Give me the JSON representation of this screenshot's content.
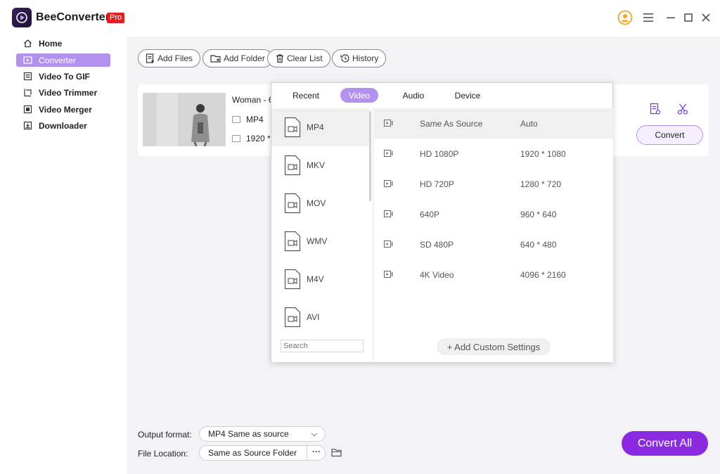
{
  "app": {
    "title": "BeeConverter",
    "badge": "Pro"
  },
  "sidebar": {
    "items": [
      {
        "label": "Home",
        "icon": "home-icon"
      },
      {
        "label": "Converter",
        "icon": "converter-icon",
        "active": true
      },
      {
        "label": "Video To GIF",
        "icon": "gif-icon"
      },
      {
        "label": "Video Trimmer",
        "icon": "trim-icon"
      },
      {
        "label": "Video Merger",
        "icon": "merge-icon"
      },
      {
        "label": "Downloader",
        "icon": "download-icon"
      }
    ]
  },
  "toolbar": {
    "add_files": "Add Files",
    "add_folder": "Add Folder",
    "clear_list": "Clear List",
    "history": "History"
  },
  "file": {
    "name": "Woman - 6",
    "format": "MP4",
    "resolution": "1920 *",
    "convert_label": "Convert"
  },
  "popup": {
    "tabs": [
      "Recent",
      "Video",
      "Audio",
      "Device"
    ],
    "active_tab": "Video",
    "formats": [
      "MP4",
      "MKV",
      "MOV",
      "WMV",
      "M4V",
      "AVI"
    ],
    "active_format": "MP4",
    "search_placeholder": "Search",
    "presets": [
      {
        "name": "Same As Source",
        "size": "Auto"
      },
      {
        "name": "HD 1080P",
        "size": "1920 * 1080"
      },
      {
        "name": "HD 720P",
        "size": "1280 * 720"
      },
      {
        "name": "640P",
        "size": "960 * 640"
      },
      {
        "name": "SD 480P",
        "size": "640 * 480"
      },
      {
        "name": "4K Video",
        "size": "4096 * 2160"
      }
    ],
    "custom_label": "+ Add Custom Settings"
  },
  "bottom": {
    "output_label": "Output format:",
    "output_value": "MP4 Same as source",
    "location_label": "File Location:",
    "location_value": "Same as Source Folder",
    "more": "···",
    "convert_all": "Convert All"
  },
  "colors": {
    "accent": "#b392ee",
    "primary": "#8a2be2",
    "pro": "#e02020",
    "user": "#f5a623"
  }
}
